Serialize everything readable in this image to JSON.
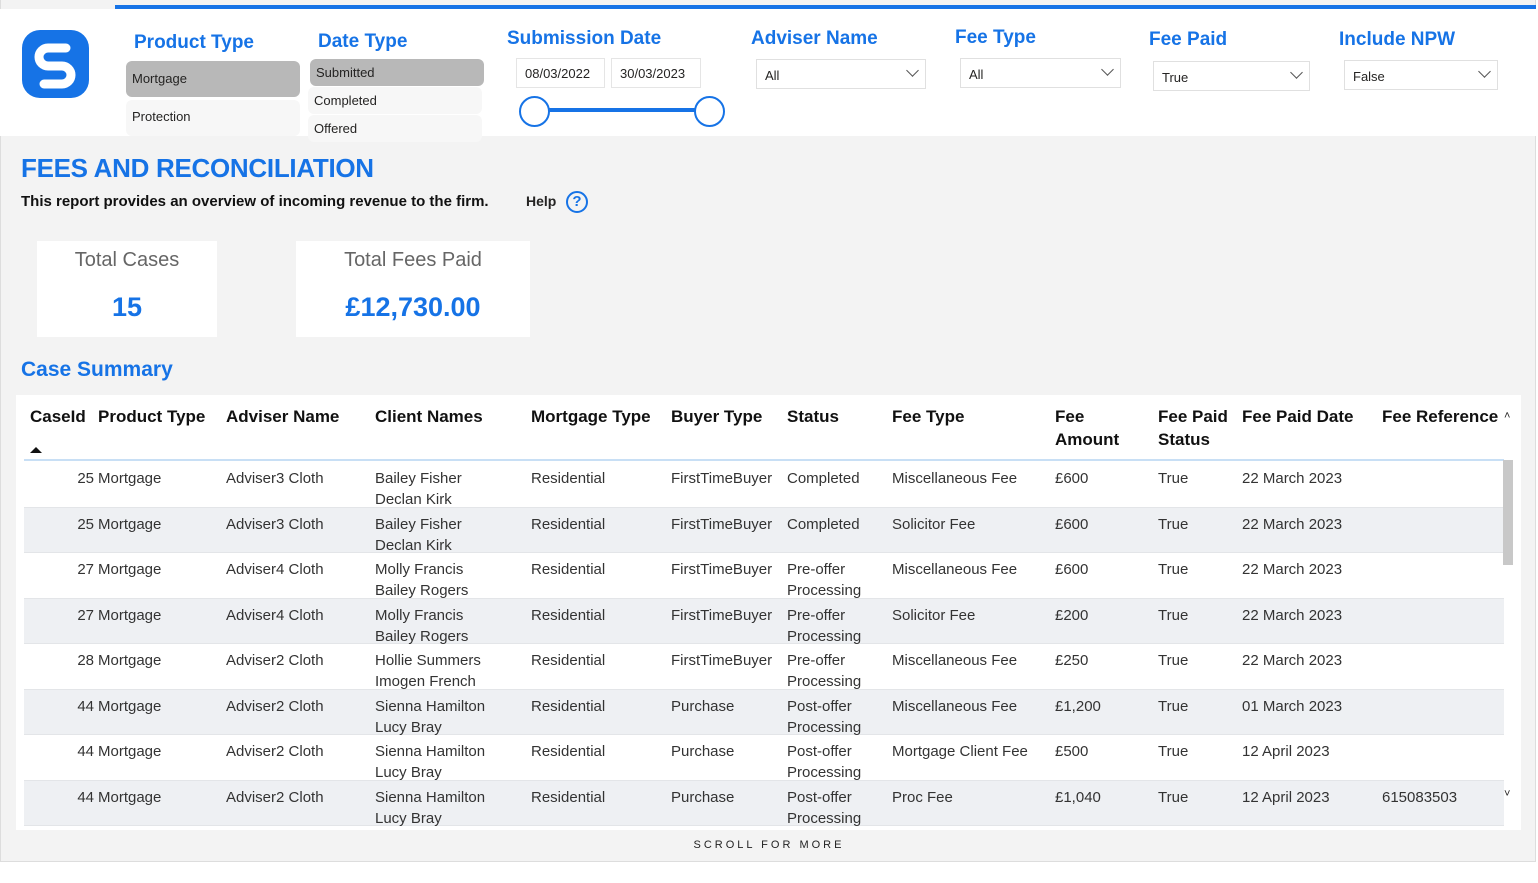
{
  "colors": {
    "accent": "#1673e6",
    "selected": "#b8b8b8"
  },
  "filters": {
    "product_type": {
      "title": "Product Type",
      "options": [
        "Mortgage",
        "Protection"
      ],
      "selected": "Mortgage"
    },
    "date_type": {
      "title": "Date Type",
      "options": [
        "Submitted",
        "Completed",
        "Offered"
      ],
      "selected": "Submitted"
    },
    "submission_date": {
      "title": "Submission Date",
      "start": "08/03/2022",
      "end": "30/03/2023"
    },
    "adviser_name": {
      "title": "Adviser Name",
      "value": "All"
    },
    "fee_type": {
      "title": "Fee Type",
      "value": "All"
    },
    "fee_paid": {
      "title": "Fee Paid",
      "value": "True"
    },
    "include_npw": {
      "title": "Include NPW",
      "value": "False"
    }
  },
  "page": {
    "title": "FEES AND RECONCILIATION",
    "description": "This report provides an overview of incoming revenue to the firm.",
    "help_label": "Help",
    "help_icon": "question-circle-icon"
  },
  "kpis": [
    {
      "label": "Total Cases",
      "value": "15"
    },
    {
      "label": "Total Fees Paid",
      "value": "£12,730.00"
    }
  ],
  "table": {
    "title": "Case Summary",
    "sort": "CaseId ascending",
    "columns": [
      "CaseId",
      "Product Type",
      "Adviser Name",
      "Client Names",
      "Mortgage Type",
      "Buyer Type",
      "Status",
      "Fee Type",
      "Fee\nAmount",
      "Fee Paid\nStatus",
      "Fee Paid Date",
      "Fee Reference"
    ],
    "rows": [
      [
        "25",
        "Mortgage",
        "Adviser3 Cloth",
        "Bailey Fisher\nDeclan Kirk",
        "Residential",
        "FirstTimeBuyer",
        "Completed",
        "Miscellaneous Fee",
        "£600",
        "True",
        "22 March 2023",
        ""
      ],
      [
        "25",
        "Mortgage",
        "Adviser3 Cloth",
        "Bailey Fisher\nDeclan Kirk",
        "Residential",
        "FirstTimeBuyer",
        "Completed",
        "Solicitor Fee",
        "£600",
        "True",
        "22 March 2023",
        ""
      ],
      [
        "27",
        "Mortgage",
        "Adviser4 Cloth",
        "Molly Francis\nBailey Rogers",
        "Residential",
        "FirstTimeBuyer",
        "Pre-offer\nProcessing",
        "Miscellaneous Fee",
        "£600",
        "True",
        "22 March 2023",
        ""
      ],
      [
        "27",
        "Mortgage",
        "Adviser4 Cloth",
        "Molly Francis\nBailey Rogers",
        "Residential",
        "FirstTimeBuyer",
        "Pre-offer\nProcessing",
        "Solicitor Fee",
        "£200",
        "True",
        "22 March 2023",
        ""
      ],
      [
        "28",
        "Mortgage",
        "Adviser2 Cloth",
        "Hollie Summers\nImogen French",
        "Residential",
        "FirstTimeBuyer",
        "Pre-offer\nProcessing",
        "Miscellaneous Fee",
        "£250",
        "True",
        "22 March 2023",
        ""
      ],
      [
        "44",
        "Mortgage",
        "Adviser2 Cloth",
        "Sienna Hamilton\nLucy Bray",
        "Residential",
        "Purchase",
        "Post-offer\nProcessing",
        "Miscellaneous Fee",
        "£1,200",
        "True",
        "01 March 2023",
        ""
      ],
      [
        "44",
        "Mortgage",
        "Adviser2 Cloth",
        "Sienna Hamilton\nLucy Bray",
        "Residential",
        "Purchase",
        "Post-offer\nProcessing",
        "Mortgage Client Fee",
        "£500",
        "True",
        "12 April 2023",
        ""
      ],
      [
        "44",
        "Mortgage",
        "Adviser2 Cloth",
        "Sienna Hamilton\nLucy Bray",
        "Residential",
        "Purchase",
        "Post-offer\nProcessing",
        "Proc Fee",
        "£1,040",
        "True",
        "12 April 2023",
        "615083503"
      ]
    ]
  },
  "footer": {
    "scroll_hint": "SCROLL FOR MORE"
  }
}
